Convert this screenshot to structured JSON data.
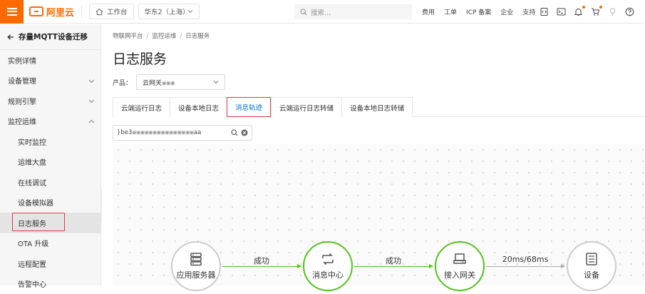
{
  "topbar": {
    "logo_text": "阿里云",
    "workbench": "工作台",
    "region": "华东2（上海）",
    "search_placeholder": "搜索...",
    "links": [
      "费用",
      "工单",
      "ICP 备案",
      "企业",
      "支持"
    ],
    "accent_color": "#ff6a00"
  },
  "sidebar": {
    "back_label": "存量MQTT设备迁移",
    "items": [
      {
        "label": "实例详情",
        "sub": false
      },
      {
        "label": "设备管理",
        "sub": false,
        "expandable": true
      },
      {
        "label": "规则引擎",
        "sub": false,
        "expandable": true
      },
      {
        "label": "监控运维",
        "sub": false,
        "expanded": true
      },
      {
        "label": "实时监控",
        "sub": true
      },
      {
        "label": "运维大盘",
        "sub": true
      },
      {
        "label": "在线调试",
        "sub": true
      },
      {
        "label": "设备模拟器",
        "sub": true
      },
      {
        "label": "日志服务",
        "sub": true,
        "active": true
      },
      {
        "label": "OTA 升级",
        "sub": true
      },
      {
        "label": "远程配置",
        "sub": true
      },
      {
        "label": "告警中心",
        "sub": true
      }
    ]
  },
  "main": {
    "breadcrumb": [
      "物联网平台",
      "监控运维",
      "日志服务"
    ],
    "title": "日志服务",
    "product_label": "产品：",
    "product_value": "云网关",
    "tabs": [
      {
        "label": "云端运行日志"
      },
      {
        "label": "设备本地日志"
      },
      {
        "label": "消息轨迹",
        "active": true
      },
      {
        "label": "云端运行日志转储"
      },
      {
        "label": "设备本地日志转储"
      }
    ],
    "filter_value": "}be3",
    "filter_suffix": "aa"
  },
  "flow": {
    "nodes": [
      {
        "label": "应用服务器",
        "icon": "server-icon",
        "status": "neutral"
      },
      {
        "label": "消息中心",
        "icon": "message-center-icon",
        "status": "success"
      },
      {
        "label": "接入网关",
        "icon": "gateway-icon",
        "status": "success"
      },
      {
        "label": "设备",
        "icon": "device-icon",
        "status": "neutral"
      }
    ],
    "edges": [
      {
        "label": "成功"
      },
      {
        "label": "成功"
      },
      {
        "label": "20ms/68ms"
      }
    ],
    "success_color": "#52c41a"
  }
}
